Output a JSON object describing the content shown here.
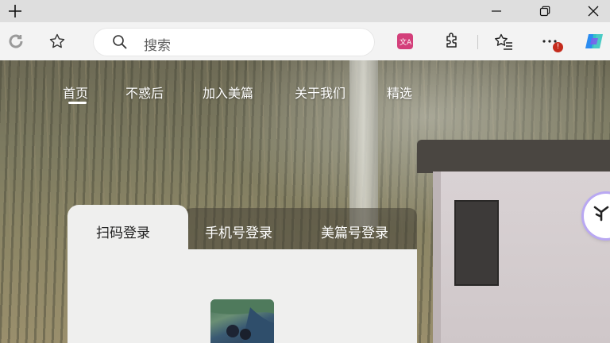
{
  "browser": {
    "window_controls": {
      "minimize": "—",
      "maximize": "❐",
      "close": "✕"
    },
    "new_tab_icon": "plus-icon",
    "omnibox": {
      "placeholder": "搜索"
    },
    "notification_badge": "!",
    "colors": {
      "titlebar": "#dedede",
      "toolbar": "#f3f3f3",
      "translate_icon": "#d33f7a",
      "badge": "#c42b1c"
    }
  },
  "site": {
    "nav": {
      "items": [
        {
          "label": "首页",
          "active": true
        },
        {
          "label": "不惑后",
          "active": false
        },
        {
          "label": "加入美篇",
          "active": false
        },
        {
          "label": "关于我们",
          "active": false
        },
        {
          "label": "精选",
          "active": false
        }
      ]
    },
    "login": {
      "tabs": [
        {
          "label": "扫码登录",
          "active": true
        },
        {
          "label": "手机号登录",
          "active": false
        },
        {
          "label": "美篇号登录",
          "active": false
        }
      ]
    }
  }
}
